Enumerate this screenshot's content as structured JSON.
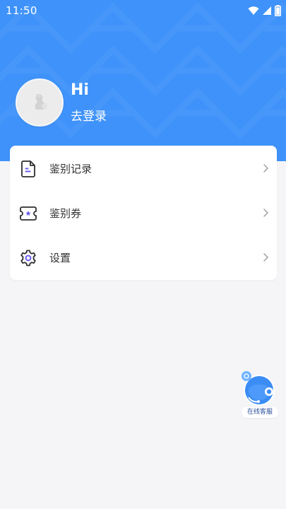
{
  "status_bar": {
    "time": "11:50",
    "icons": [
      "wifi-icon",
      "cellular-signal-icon",
      "battery-icon"
    ]
  },
  "profile": {
    "avatar_icon": "user-avatar-placeholder",
    "greeting": "Hi",
    "login_label": "去登录"
  },
  "menu": {
    "items": [
      {
        "label": "鉴别记录",
        "icon": "document-icon"
      },
      {
        "label": "鉴别券",
        "icon": "ticket-icon"
      },
      {
        "label": "设置",
        "icon": "gear-icon"
      }
    ]
  },
  "customer_service": {
    "label": "在线客服",
    "icon": "headset-icon"
  },
  "colors": {
    "header": "#3e92f9",
    "background": "#f5f5f7",
    "card": "#ffffff",
    "text": "#333333",
    "accent_purple": "#6a5cf2"
  }
}
